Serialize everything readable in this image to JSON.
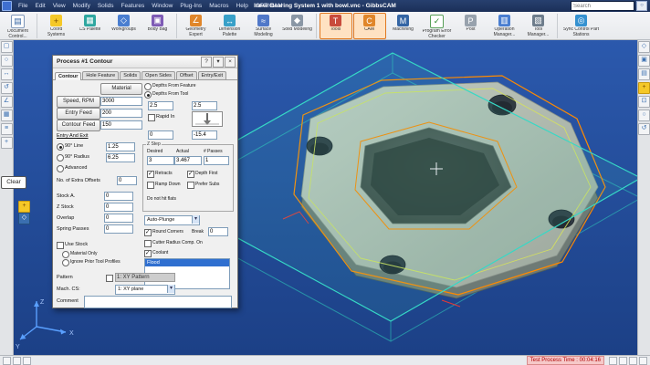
{
  "titlebar": {
    "title": "Inner Bearing System  1 with bowl.vnc - GibbsCAM",
    "menus": [
      "File",
      "Edit",
      "View",
      "Modify",
      "Solids",
      "Features",
      "Window",
      "Plug-Ins",
      "Macros",
      "Help",
      "OPTICAM"
    ],
    "search_placeholder": "Search",
    "search_icon": "○"
  },
  "ribbon": {
    "items": [
      {
        "label": "Document Control...",
        "icon": "▤"
      },
      {
        "label": "Coord Systems",
        "icon": "+"
      },
      {
        "label": "CS Palette",
        "icon": "▦"
      },
      {
        "label": "Workgroups",
        "icon": "◇"
      },
      {
        "label": "Body Bag",
        "icon": "▣"
      },
      {
        "label": "Geometry Expert",
        "icon": "∠"
      },
      {
        "label": "Dimension Palette",
        "icon": "↔"
      },
      {
        "label": "Surface Modeling",
        "icon": "≈"
      },
      {
        "label": "Solid Modeling",
        "icon": "◆"
      },
      {
        "label": "Tools",
        "icon": "T"
      },
      {
        "label": "CAM",
        "icon": "C"
      },
      {
        "label": "Machining",
        "icon": "M"
      },
      {
        "label": "Program Error Checker",
        "icon": "✓"
      },
      {
        "label": "Post",
        "icon": "P"
      },
      {
        "label": "Operation Manager...",
        "icon": "▥"
      },
      {
        "label": "Tool Manager...",
        "icon": "▧"
      },
      {
        "label": "Sync Control Part Stations",
        "icon": "◎"
      }
    ]
  },
  "left_panel": {
    "clear_button": "Clear"
  },
  "viewport": {
    "axis": {
      "x": "X",
      "y": "Y",
      "z": "Z"
    }
  },
  "dialog": {
    "title": "Process #1 Contour",
    "tabs": [
      "Contour",
      "Hole Feature",
      "Solids",
      "Open Sides",
      "Offset",
      "Entry/Exit"
    ],
    "material_button": "Material",
    "feeds": [
      {
        "label": "Speed, RPM",
        "value": "3000"
      },
      {
        "label": "Entry Feed",
        "value": "200"
      },
      {
        "label": "Contour Feed",
        "value": "150"
      }
    ],
    "depths_from_feature": "Depths From Feature",
    "depths_from_tool": "Depths From Tool",
    "surface_top": "2.5",
    "surface_top2": "2.5",
    "rapid_in": "Rapid In",
    "depth_z": "0",
    "depth_z2": "-15.4",
    "entry_exit_link": "Entry And Exit",
    "line90_label": "90° Line",
    "line90_value": "1.25",
    "radius90_label": "90° Radius",
    "radius90_value": "6.25",
    "advanced_label": "Advanced",
    "extra_offsets_label": "No. of Extra Offsets",
    "extra_offsets_value": "0",
    "zstep": {
      "title": "Z Step",
      "col_desired": "Desired",
      "col_actual": "Actual",
      "col_passes": "# Passes",
      "desired": "3",
      "actual": "3.467",
      "passes": "1",
      "retracts": "Retracts",
      "depth_first": "Depth First",
      "ramp_down": "Ramp Down",
      "prefer_subs": "Prefer Subs",
      "no_flats": "Do not hit flats"
    },
    "stock_rows": [
      {
        "label": "Stock A.",
        "value": "0"
      },
      {
        "label": "Z Stock",
        "value": "0"
      },
      {
        "label": "Overlap",
        "value": "0"
      },
      {
        "label": "Spring Passes",
        "value": "0"
      }
    ],
    "auto_plunge": "Auto-Plunge",
    "round_corners": "Round Corners",
    "break_label": "Break",
    "break_value": "0",
    "crc_label": "Cutter Radius Comp. On",
    "coolant_label": "Coolant",
    "coolant_selected": "Flood",
    "use_stock": "Use Stock",
    "material_only": "Material Only",
    "ignore_prior": "Ignore Prior Tool Profiles",
    "pattern_label": "Pattern",
    "pattern_value": "1: XY Pattern",
    "mach_cs_label": "Mach. CS:",
    "mach_cs_value": "1: XY plane",
    "comment_label": "Comment"
  },
  "statusbar": {
    "process_time": "Test Process Time : 00:04:16"
  }
}
